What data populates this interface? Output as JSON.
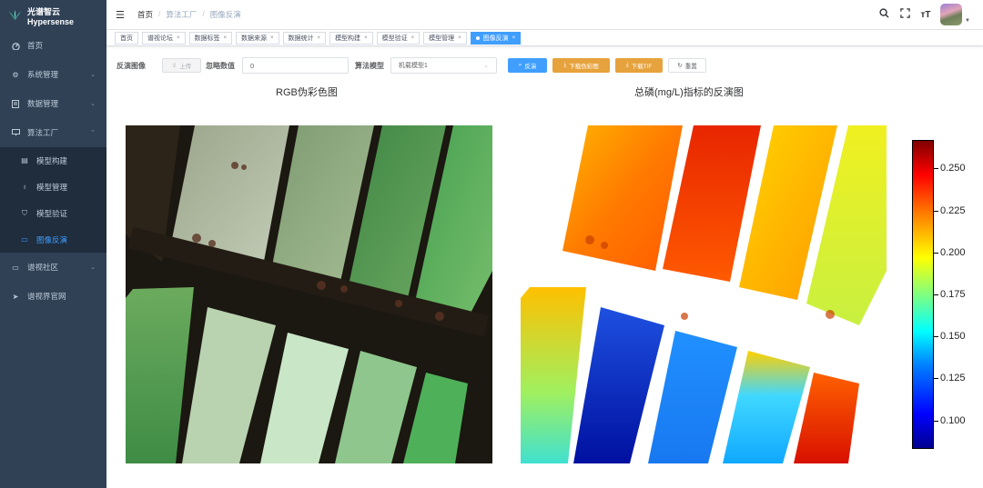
{
  "app": {
    "logo_text": "光谱智云Hypersense"
  },
  "sidebar": {
    "items": [
      {
        "label": "首页",
        "icon": "dashboard-icon"
      },
      {
        "label": "系统管理",
        "icon": "gear-icon"
      },
      {
        "label": "数据管理",
        "icon": "document-icon"
      },
      {
        "label": "算法工厂",
        "icon": "monitor-icon"
      },
      {
        "label": "谱视社区",
        "icon": "chat-icon"
      },
      {
        "label": "谱视界官网",
        "icon": "send-icon"
      }
    ],
    "submenu": [
      {
        "label": "模型构建",
        "icon": "grid-icon"
      },
      {
        "label": "模型管理",
        "icon": "tree-icon"
      },
      {
        "label": "模型验证",
        "icon": "shield-icon"
      },
      {
        "label": "图像反演",
        "icon": "image-icon",
        "active": true
      }
    ]
  },
  "header": {
    "breadcrumb": [
      "首页",
      "算法工厂",
      "图像反演"
    ],
    "icons": [
      "search-icon",
      "fullscreen-icon",
      "font-size-icon"
    ]
  },
  "tags": [
    {
      "label": "首页",
      "closable": false
    },
    {
      "label": "谱视论坛"
    },
    {
      "label": "数据标签"
    },
    {
      "label": "数据来源"
    },
    {
      "label": "数据统计"
    },
    {
      "label": "模型构建"
    },
    {
      "label": "模型验证"
    },
    {
      "label": "模型管理"
    },
    {
      "label": "图像反演",
      "active": true
    }
  ],
  "toolbar": {
    "invert_image_label": "反演图像",
    "upload_label": "上传",
    "ignore_value_label": "忽略数值",
    "ignore_value": "0",
    "algorithm_model_label": "算法模型",
    "algorithm_model_value": "机载模型1",
    "invert_button": "反演",
    "download_tif_button": "下载TIF",
    "reset_button": "重置",
    "download_multi_button": "下载伪彩图"
  },
  "panels": {
    "left_title": "RGB伪彩色图",
    "right_title": "总磷(mg/L)指标的反演图"
  },
  "colorbar": {
    "ticks": [
      "0.250",
      "0.225",
      "0.200",
      "0.175",
      "0.150",
      "0.125",
      "0.100"
    ],
    "tick_values": [
      0.25,
      0.225,
      0.2,
      0.175,
      0.15,
      0.125,
      0.1
    ],
    "min": 0.083,
    "max": 0.267,
    "colormap": "jet"
  },
  "colors": {
    "sidebar_bg": "#304156",
    "submenu_bg": "#1f2d3d",
    "accent": "#409eff",
    "warning": "#e6a23c"
  }
}
